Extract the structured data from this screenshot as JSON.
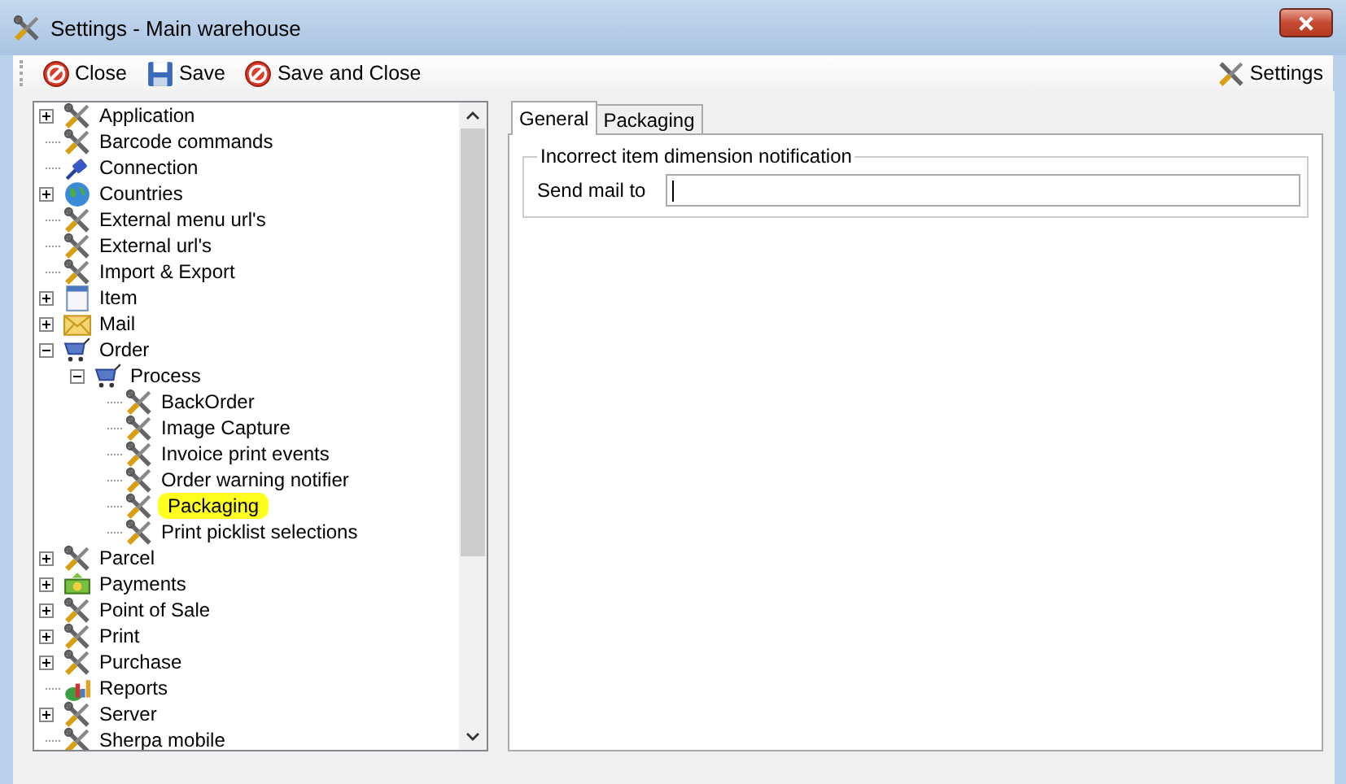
{
  "window": {
    "title": "Settings - Main warehouse"
  },
  "toolbar": {
    "buttons": [
      {
        "label": "Close",
        "kind": "close"
      },
      {
        "label": "Save",
        "kind": "save"
      },
      {
        "label": "Save and Close",
        "kind": "close"
      }
    ],
    "settings_button": "Settings"
  },
  "tree": [
    {
      "label": "Application",
      "kind": "tools",
      "expanded": false,
      "selected": false
    },
    {
      "label": "Barcode commands",
      "kind": "tools",
      "selected": false
    },
    {
      "label": "Connection",
      "kind": "plug",
      "selected": false
    },
    {
      "label": "Countries",
      "kind": "globe",
      "expanded": false,
      "selected": false
    },
    {
      "label": "External menu url's",
      "kind": "tools",
      "selected": false
    },
    {
      "label": "External url's",
      "kind": "tools",
      "selected": false
    },
    {
      "label": "Import & Export",
      "kind": "tools",
      "selected": false
    },
    {
      "label": "Item",
      "kind": "window",
      "expanded": false,
      "selected": false
    },
    {
      "label": "Mail",
      "kind": "mail",
      "expanded": false,
      "selected": false
    },
    {
      "label": "Order",
      "kind": "cart",
      "expanded": true,
      "selected": false,
      "children": [
        {
          "label": "Process",
          "kind": "cart",
          "expanded": true,
          "selected": false,
          "children": [
            {
              "label": "BackOrder",
              "kind": "tools",
              "selected": false
            },
            {
              "label": "Image Capture",
              "kind": "tools",
              "selected": false
            },
            {
              "label": "Invoice print events",
              "kind": "tools",
              "selected": false
            },
            {
              "label": "Order warning notifier",
              "kind": "tools",
              "selected": false
            },
            {
              "label": "Packaging",
              "kind": "tools",
              "selected": true
            },
            {
              "label": "Print picklist selections",
              "kind": "tools",
              "selected": false
            }
          ]
        }
      ]
    },
    {
      "label": "Parcel",
      "kind": "tools",
      "expanded": false,
      "selected": false
    },
    {
      "label": "Payments",
      "kind": "money",
      "expanded": false,
      "selected": false
    },
    {
      "label": "Point of Sale",
      "kind": "tools",
      "expanded": false,
      "selected": false
    },
    {
      "label": "Print",
      "kind": "tools",
      "expanded": false,
      "selected": false
    },
    {
      "label": "Purchase",
      "kind": "tools",
      "expanded": false,
      "selected": false
    },
    {
      "label": "Reports",
      "kind": "chart",
      "selected": false
    },
    {
      "label": "Server",
      "kind": "tools",
      "expanded": false,
      "selected": false
    },
    {
      "label": "Sherpa mobile",
      "kind": "tools",
      "selected": false
    }
  ],
  "tabs": [
    {
      "label": "General",
      "selected": true
    },
    {
      "label": "Packaging",
      "selected": false
    }
  ],
  "group": {
    "title": "Incorrect item dimension notification",
    "field_label": "Send mail to"
  }
}
